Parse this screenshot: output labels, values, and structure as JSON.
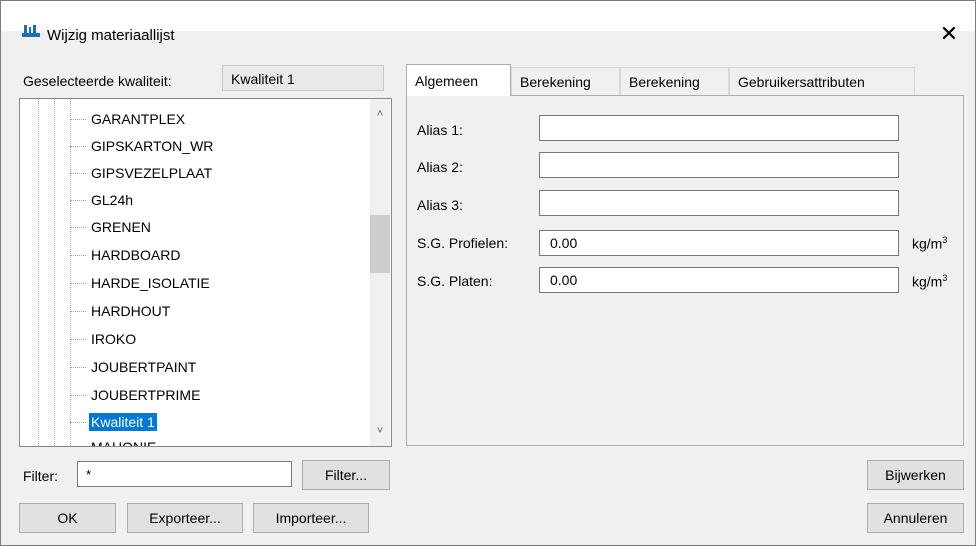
{
  "window": {
    "title": "Wijzig materiaallijst",
    "icon": "app-ruler-icon",
    "close_glyph": "✕"
  },
  "selection": {
    "label": "Geselecteerde kwaliteit:",
    "value": "Kwaliteit 1"
  },
  "tree": {
    "items": [
      "GARANTPLEX",
      "GIPSKARTON_WR",
      "GIPSVEZELPLAAT",
      "GL24h",
      "GRENEN",
      "HARDBOARD",
      "HARDE_ISOLATIE",
      "HARDHOUT",
      "IROKO",
      "JOUBERTPAINT",
      "JOUBERTPRIME",
      "Kwaliteit 1",
      "MAHONIE"
    ],
    "selected": "Kwaliteit 1",
    "scroll_up": "˄",
    "scroll_down": "˅"
  },
  "tabs": [
    {
      "label": "Algemeen",
      "active": true
    },
    {
      "label": "Berekening",
      "active": false
    },
    {
      "label": "Berekening",
      "active": false
    },
    {
      "label": "Gebruikersattributen",
      "active": false
    }
  ],
  "form": {
    "alias1": {
      "label": "Alias 1:",
      "value": ""
    },
    "alias2": {
      "label": "Alias 2:",
      "value": ""
    },
    "alias3": {
      "label": "Alias 3:",
      "value": ""
    },
    "sg_profielen": {
      "label": "S.G. Profielen:",
      "value": "0.00",
      "unit": "kg/m",
      "unit_sup": "3"
    },
    "sg_platen": {
      "label": "S.G. Platen:",
      "value": "0.00",
      "unit": "kg/m",
      "unit_sup": "3"
    }
  },
  "filter": {
    "label": "Filter:",
    "value": "*",
    "button": "Filter..."
  },
  "buttons": {
    "bijwerken": "Bijwerken",
    "ok": "OK",
    "exporteer": "Exporteer...",
    "importeer": "Importeer...",
    "annuleren": "Annuleren"
  },
  "colors": {
    "selection": "#0078d7",
    "window_bg": "#f0f0f0"
  }
}
